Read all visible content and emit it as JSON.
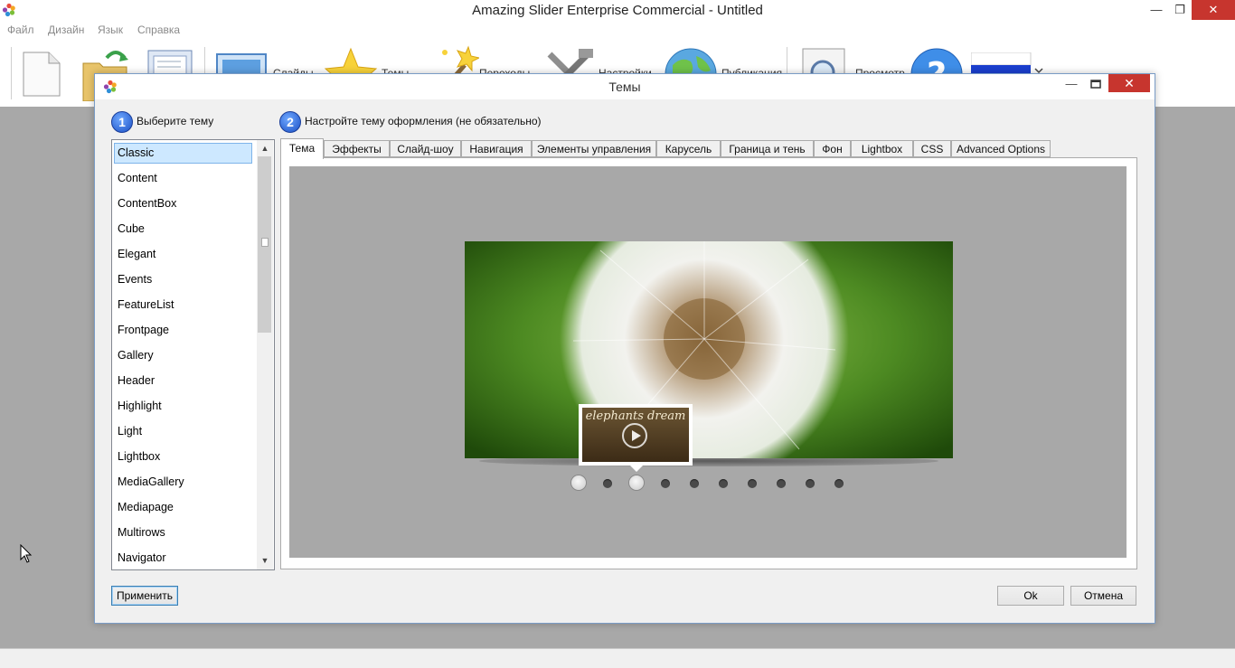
{
  "app": {
    "title": "Amazing Slider Enterprise Commercial - Untitled",
    "minimize_symbol": "—",
    "restore_symbol": "❐",
    "close_symbol": "✕"
  },
  "menu": [
    "Файл",
    "Дизайн",
    "Язык",
    "Справка"
  ],
  "toolbar": {
    "buttons": [
      {
        "icon": "new-file-icon",
        "label": ""
      },
      {
        "icon": "open-folder-icon",
        "label": ""
      },
      {
        "icon": "save-icon",
        "label": ""
      },
      {
        "icon": "slides-icon",
        "label": "Слайды"
      },
      {
        "icon": "star-icon",
        "label": "Темы"
      },
      {
        "icon": "magic-wand-icon",
        "label": "Переходы"
      },
      {
        "icon": "tools-icon",
        "label": "Настройки"
      },
      {
        "icon": "globe-icon",
        "label": "Публикация"
      },
      {
        "icon": "magnifier-icon",
        "label": "Просмотр"
      },
      {
        "icon": "help-icon",
        "label": ""
      },
      {
        "icon": "russian-flag-icon",
        "label": ""
      }
    ]
  },
  "dialog": {
    "title": "Темы",
    "minimize_symbol": "—",
    "close_symbol": "✕",
    "step1": {
      "number": "1",
      "text": "Выберите тему"
    },
    "step2": {
      "number": "2",
      "text": "Настройте тему оформления (не обязательно)"
    },
    "themes": [
      "Classic",
      "Content",
      "ContentBox",
      "Cube",
      "Elegant",
      "Events",
      "FeatureList",
      "Frontpage",
      "Gallery",
      "Header",
      "Highlight",
      "Light",
      "Lightbox",
      "MediaGallery",
      "Mediapage",
      "Multirows",
      "Navigator"
    ],
    "selected_theme": "Classic",
    "scroll_up_symbol": "▲",
    "scroll_down_symbol": "▼",
    "tabs": [
      "Тема",
      "Эффекты",
      "Слайд-шоу",
      "Навигация",
      "Элементы управления",
      "Карусель",
      "Граница и тень",
      "Фон",
      "Lightbox",
      "CSS",
      "Advanced Options"
    ],
    "active_tab": "Тема",
    "preview": {
      "thumbnail_caption": "elephants dream",
      "bullet_count": 10,
      "play_bullets": [
        0,
        2
      ]
    },
    "buttons": {
      "apply": "Применить",
      "ok": "Ok",
      "cancel": "Отмена"
    }
  },
  "colors": {
    "accent_blue": "#1a4fc4",
    "close_red": "#c7352e",
    "workspace_gray": "#a8a8a8",
    "selection": "#cde8ff"
  }
}
